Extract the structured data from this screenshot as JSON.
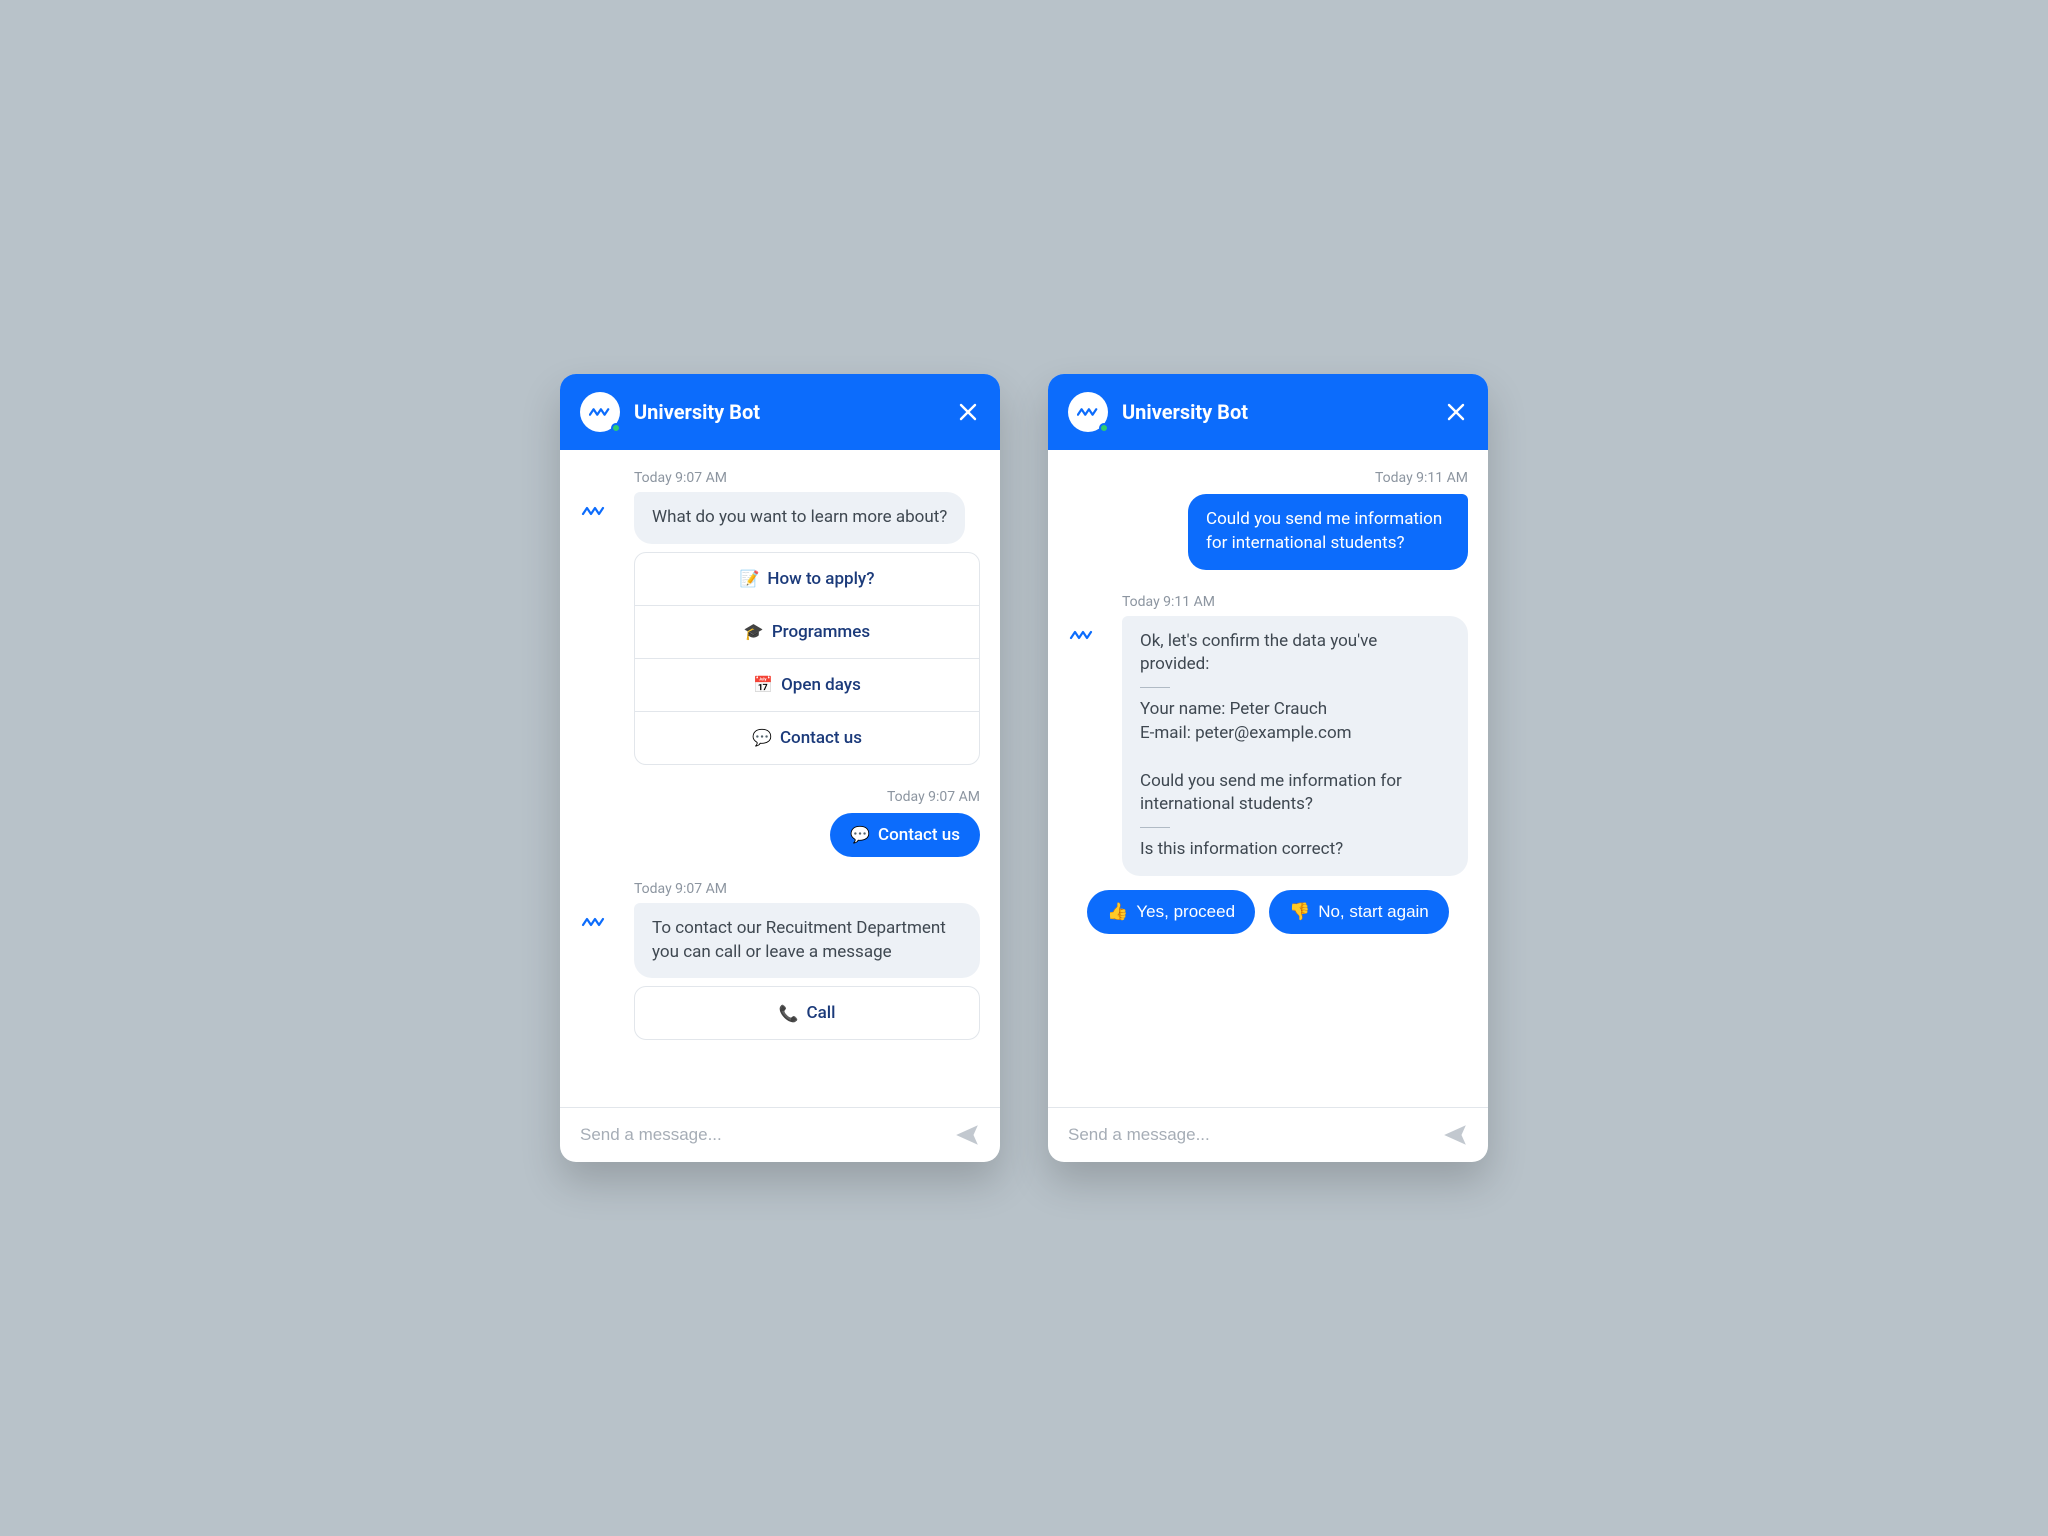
{
  "panel1": {
    "header": {
      "title": "University Bot"
    },
    "blocks": {
      "b1": {
        "timestamp": "Today 9:07 AM",
        "bot_text": "What do you want to learn more about?",
        "options": [
          {
            "emoji": "📝",
            "label": "How to apply?"
          },
          {
            "emoji": "🎓",
            "label": "Programmes"
          },
          {
            "emoji": "📅",
            "label": "Open days"
          },
          {
            "emoji": "💬",
            "label": "Contact us"
          }
        ]
      },
      "b2": {
        "timestamp": "Today 9:07 AM",
        "user_text": "Contact us",
        "user_emoji": "💬"
      },
      "b3": {
        "timestamp": "Today 9:07 AM",
        "bot_text": "To contact our Recuitment Department you can call or leave a message",
        "options": [
          {
            "emoji": "📞",
            "label": "Call"
          }
        ]
      }
    },
    "footer": {
      "placeholder": "Send a message..."
    }
  },
  "panel2": {
    "header": {
      "title": "University Bot"
    },
    "blocks": {
      "b1": {
        "timestamp": "Today 9:11 AM",
        "user_text": "Could you send me information for international students?"
      },
      "b2": {
        "timestamp": "Today 9:11 AM",
        "bot_lines": {
          "l1": "Ok, let's confirm the data you've provided:",
          "l2": "Your name: Peter Crauch",
          "l3": "E-mail: peter@example.com",
          "l4": "Could you send me information for international students?",
          "l5": "Is this information correct?"
        },
        "actions": [
          {
            "emoji": "👍",
            "label": "Yes, proceed"
          },
          {
            "emoji": "👎",
            "label": "No, start again"
          }
        ]
      }
    },
    "footer": {
      "placeholder": "Send a message..."
    }
  }
}
